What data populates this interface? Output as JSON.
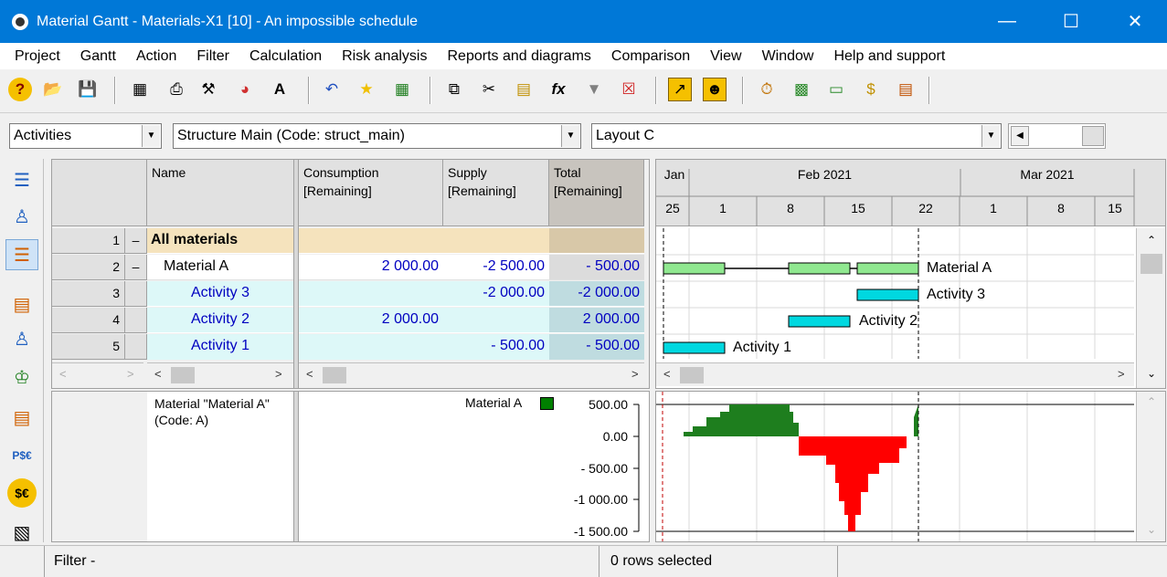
{
  "window": {
    "title": "Material Gantt - Materials-X1 [10] - An impossible schedule",
    "minimize": "—",
    "maximize": "☐",
    "close": "✕"
  },
  "menu": [
    "Project",
    "Gantt",
    "Action",
    "Filter",
    "Calculation",
    "Risk analysis",
    "Reports and diagrams",
    "Comparison",
    "View",
    "Window",
    "Help and support"
  ],
  "toolbar": {
    "icons": [
      "help-icon",
      "open-folder-icon",
      "save-icon",
      "columns-icon",
      "print-icon",
      "tools-icon",
      "pie-chart-icon",
      "font-icon",
      "undo-icon",
      "star-icon",
      "excel-icon",
      "copy-icon",
      "cut-icon",
      "paste-icon",
      "formula-icon",
      "filter-icon",
      "clear-filter-icon",
      "run-icon",
      "person-icon",
      "timer-icon",
      "resource-icon",
      "chart-icon",
      "cost-icon",
      "stack-icon"
    ]
  },
  "selectors": {
    "view": "Activities",
    "structure": "Structure Main (Code: struct_main)",
    "layout": "Layout C"
  },
  "table": {
    "headers": {
      "name": "Name",
      "consumption": "Consumption\n[Remaining]",
      "supply": "Supply\n[Remaining]",
      "total": "Total\n[Remaining]"
    },
    "rows": [
      {
        "num": "1",
        "toggle": "–",
        "name": "All materials",
        "consumption": "",
        "supply": "",
        "total": ""
      },
      {
        "num": "2",
        "toggle": "–",
        "name": "Material A",
        "consumption": "2 000.00",
        "supply": "-2 500.00",
        "total": "- 500.00"
      },
      {
        "num": "3",
        "toggle": "",
        "name": "Activity 3",
        "consumption": "",
        "supply": "-2 000.00",
        "total": "-2 000.00"
      },
      {
        "num": "4",
        "toggle": "",
        "name": "Activity 2",
        "consumption": "2 000.00",
        "supply": "",
        "total": "2 000.00"
      },
      {
        "num": "5",
        "toggle": "",
        "name": "Activity 1",
        "consumption": "",
        "supply": "- 500.00",
        "total": "- 500.00"
      }
    ]
  },
  "gantt": {
    "months": [
      "Jan",
      "Feb 2021",
      "Mar 2021"
    ],
    "days": [
      "25",
      "1",
      "8",
      "15",
      "22",
      "1",
      "8",
      "15"
    ],
    "bar_labels": [
      "Material A",
      "Activity 3",
      "Activity 2",
      "Activity 1"
    ]
  },
  "lower": {
    "material_desc": "Material \"Material A\"\n(Code: A)",
    "legend": "Material A",
    "legend_color": "#008000",
    "y_ticks": [
      "500.00",
      "0.00",
      "- 500.00",
      "-1 000.00",
      "-1 500.00"
    ]
  },
  "chart_data": {
    "type": "area",
    "title": "",
    "xlabel": "",
    "ylabel": "",
    "series": [
      {
        "name": "Material A",
        "color_pos": "#1e7e1e",
        "color_neg": "#ff0000"
      }
    ],
    "y_ticks": [
      500,
      0,
      -500,
      -1000,
      -1500
    ],
    "x": [
      "Jan 25",
      "Jan 28",
      "Feb 1",
      "Feb 4",
      "Feb 6",
      "Feb 8",
      "Feb 10",
      "Feb 12",
      "Feb 14",
      "Feb 16",
      "Feb 18",
      "Feb 19",
      "Feb 21",
      "Feb 22"
    ],
    "values": [
      100,
      150,
      300,
      450,
      500,
      500,
      -300,
      -400,
      -900,
      -1500,
      -900,
      -400,
      -100,
      500
    ]
  },
  "status": {
    "filter": "Filter -",
    "selected": "0 rows selected"
  }
}
